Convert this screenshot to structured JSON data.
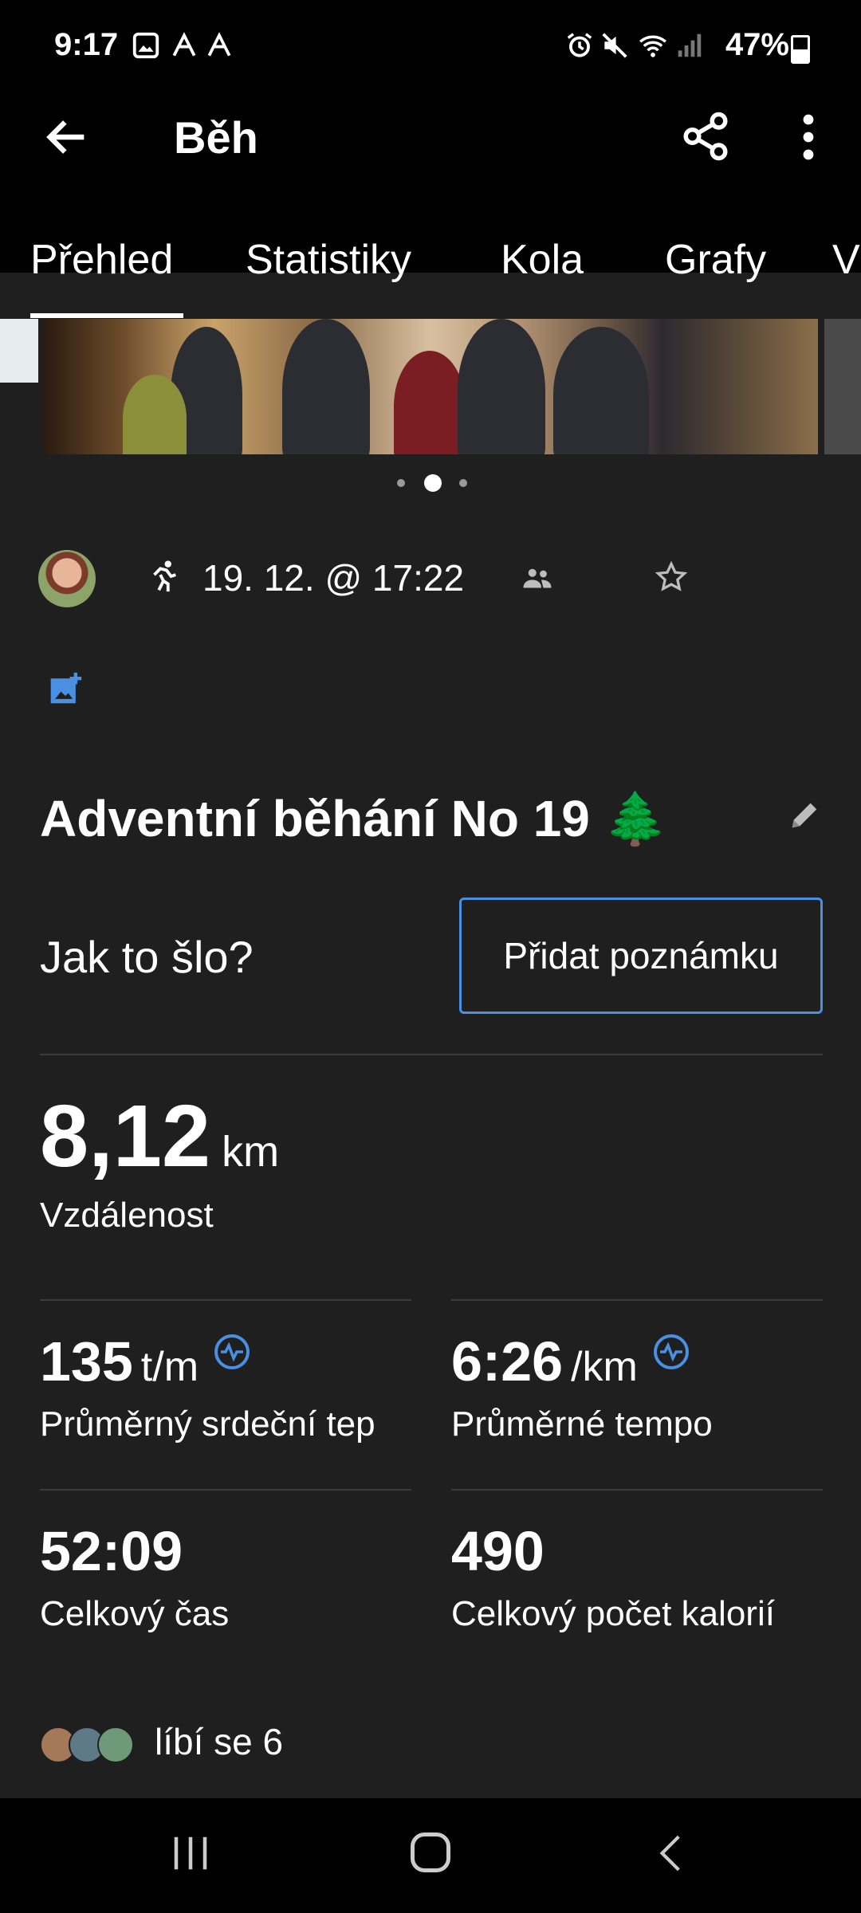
{
  "status_bar": {
    "time": "9:17",
    "battery": "47%"
  },
  "app_bar": {
    "title": "Běh"
  },
  "tabs": [
    {
      "label": "Přehled",
      "active": true
    },
    {
      "label": "Statistiky"
    },
    {
      "label": "Kola"
    },
    {
      "label": "Grafy"
    },
    {
      "label": "V"
    }
  ],
  "activity": {
    "date": "19. 12. @ 17:22",
    "name": "Adventní běhání No 19 🌲",
    "how_prompt": "Jak to šlo?",
    "add_note_label": "Přidat poznámku"
  },
  "stats": {
    "distance": {
      "value": "8,12",
      "unit": "km",
      "label": "Vzdálenost"
    },
    "avg_hr": {
      "value": "135",
      "unit": "t/m",
      "label": "Průměrný srdeční tep"
    },
    "avg_pace": {
      "value": "6:26",
      "unit": "/km",
      "label": "Průměrné tempo"
    },
    "total_time": {
      "value": "52:09",
      "label": "Celkový čas"
    },
    "calories": {
      "value": "490",
      "label": "Celkový počet kalorií"
    }
  },
  "likes": {
    "text": "líbí se 6"
  },
  "colors": {
    "accent": "#4a90e2",
    "background": "#1f1f1f"
  }
}
